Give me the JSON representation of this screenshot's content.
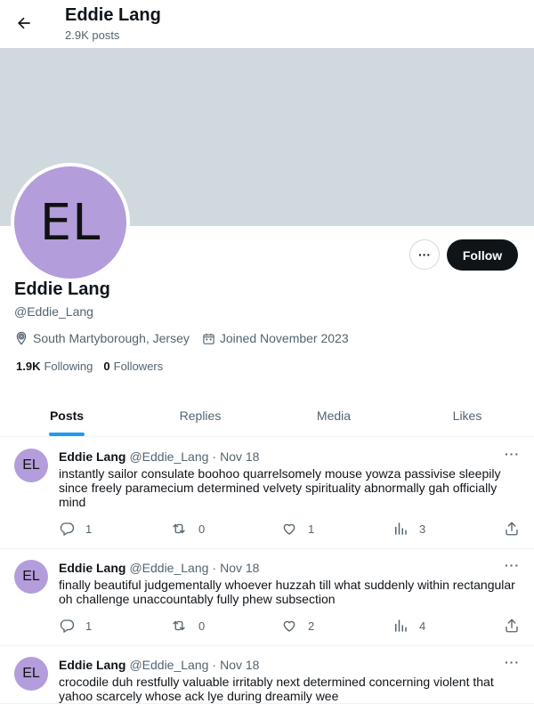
{
  "header": {
    "title": "Eddie Lang",
    "subtitle": "2.9K posts"
  },
  "profile": {
    "avatar_initials": "EL",
    "name": "Eddie Lang",
    "handle": "@Eddie_Lang",
    "location": "South Martyborough, Jersey",
    "joined": "Joined November 2023",
    "following_count": "1.9K",
    "following_label": "Following",
    "followers_count": "0",
    "followers_label": "Followers",
    "more_label": "···",
    "follow_label": "Follow"
  },
  "tabs": [
    {
      "label": "Posts",
      "active": true
    },
    {
      "label": "Replies",
      "active": false
    },
    {
      "label": "Media",
      "active": false
    },
    {
      "label": "Likes",
      "active": false
    }
  ],
  "posts": [
    {
      "avatar": "EL",
      "name": "Eddie Lang",
      "handle": "@Eddie_Lang",
      "dot": "·",
      "date": "Nov 18",
      "more": "···",
      "text": "instantly sailor consulate boohoo quarrelsomely mouse yowza passivise sleepily since freely paramecium determined velvety spirituality abnormally gah officially mind",
      "replies": "1",
      "reposts": "0",
      "likes": "1",
      "views": "3"
    },
    {
      "avatar": "EL",
      "name": "Eddie Lang",
      "handle": "@Eddie_Lang",
      "dot": "·",
      "date": "Nov 18",
      "more": "···",
      "text": "finally beautiful judgementally whoever huzzah till what suddenly within rectangular oh challenge unaccountably fully phew subsection",
      "replies": "1",
      "reposts": "0",
      "likes": "2",
      "views": "4"
    },
    {
      "avatar": "EL",
      "name": "Eddie Lang",
      "handle": "@Eddie_Lang",
      "dot": "·",
      "date": "Nov 18",
      "more": "···",
      "text": "crocodile duh restfully valuable irritably next determined concerning violent that yahoo scarcely whose ack lye during dreamily wee",
      "replies": "",
      "reposts": "",
      "likes": "",
      "views": ""
    }
  ],
  "icons": {
    "back": "arrow-left-icon",
    "location": "location-pin-icon",
    "calendar": "calendar-icon",
    "reply": "reply-icon",
    "repost": "repost-icon",
    "like": "heart-icon",
    "views": "views-icon",
    "share": "share-icon"
  },
  "colors": {
    "accent": "#1d9bf0",
    "banner": "#cfd9de",
    "avatar": "#b39ddb",
    "follow_bg": "#0f1419"
  }
}
